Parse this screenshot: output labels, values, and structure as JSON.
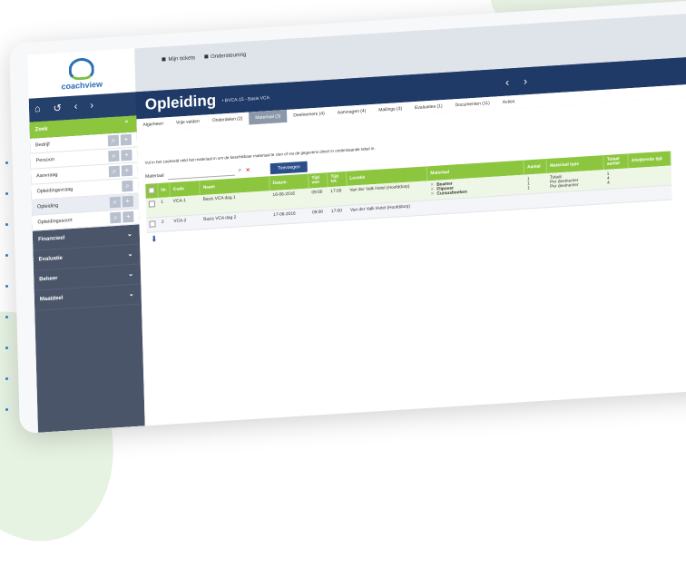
{
  "header": {
    "logo_text": "coachview",
    "links": [
      "Mijn tickets",
      "Ondersteuning"
    ]
  },
  "nav": {
    "icons": [
      "home-icon",
      "history-icon",
      "back-icon",
      "forward-icon"
    ]
  },
  "page": {
    "title": "Opleiding",
    "breadcrumb": "• BVCA-15 - Basis VCA",
    "prev": "‹",
    "next": "›"
  },
  "tabs": [
    {
      "label": "Algemeen",
      "active": false
    },
    {
      "label": "Vrije velden",
      "active": false
    },
    {
      "label": "Onderdelen (2)",
      "active": false
    },
    {
      "label": "Materiaal (3)",
      "active": true
    },
    {
      "label": "Deelnemers (4)",
      "active": false
    },
    {
      "label": "Aanvragen (4)",
      "active": false
    },
    {
      "label": "Mailings (3)",
      "active": false
    },
    {
      "label": "Evaluaties (1)",
      "active": false
    },
    {
      "label": "Documenten (11)",
      "active": false
    },
    {
      "label": "Acties",
      "active": false
    }
  ],
  "sidebar": {
    "zoek": "Zoek",
    "items": [
      "Bedrijf",
      "Persoon",
      "Aanvraag",
      "Opleidingsvraag",
      "Opleiding",
      "Opleidingssoort"
    ],
    "groups": [
      "Financieel",
      "Evaluatie",
      "Beheer",
      "Maatdeel"
    ]
  },
  "main": {
    "info": "Vul in het zoekveld veld het materiaal in om de beschikbaar materiaal te zien of via de gegevens direct in onderstaande tabel in.",
    "search_label": "Materiaal",
    "add_button": "Toevoegen",
    "columns": [
      "",
      "Nr.",
      "Code",
      "Naam",
      "Datum",
      "Tijd van",
      "Tijd tot",
      "Locatie",
      "Materiaal",
      "Aantal",
      "Materiaal type",
      "Totaal aantal",
      "Afwijkende tijd"
    ],
    "rows": [
      {
        "nr": "1",
        "code": "VCA-1",
        "naam": "Basis VCA dag 1",
        "datum": "16-06-2016",
        "van": "09:00",
        "tot": "17:00",
        "locatie": "Van der Valk Hotel (Hoofddorp)",
        "materiaal": [
          "Beamer",
          "Flipover",
          "Cursusboeken"
        ],
        "aantal": [
          "1",
          "1",
          "1"
        ],
        "type": [
          "Totaal",
          "Per deelnemer",
          "Per deelnemer"
        ],
        "totaal": [
          "1",
          "4",
          "4"
        ]
      },
      {
        "nr": "2",
        "code": "VCA-2",
        "naam": "Basis VCA dag 2",
        "datum": "17-06-2016",
        "van": "09:00",
        "tot": "17:00",
        "locatie": "Van der Valk Hotel (Hoofddorp)",
        "materiaal": [],
        "aantal": [],
        "type": [],
        "totaal": []
      }
    ]
  }
}
